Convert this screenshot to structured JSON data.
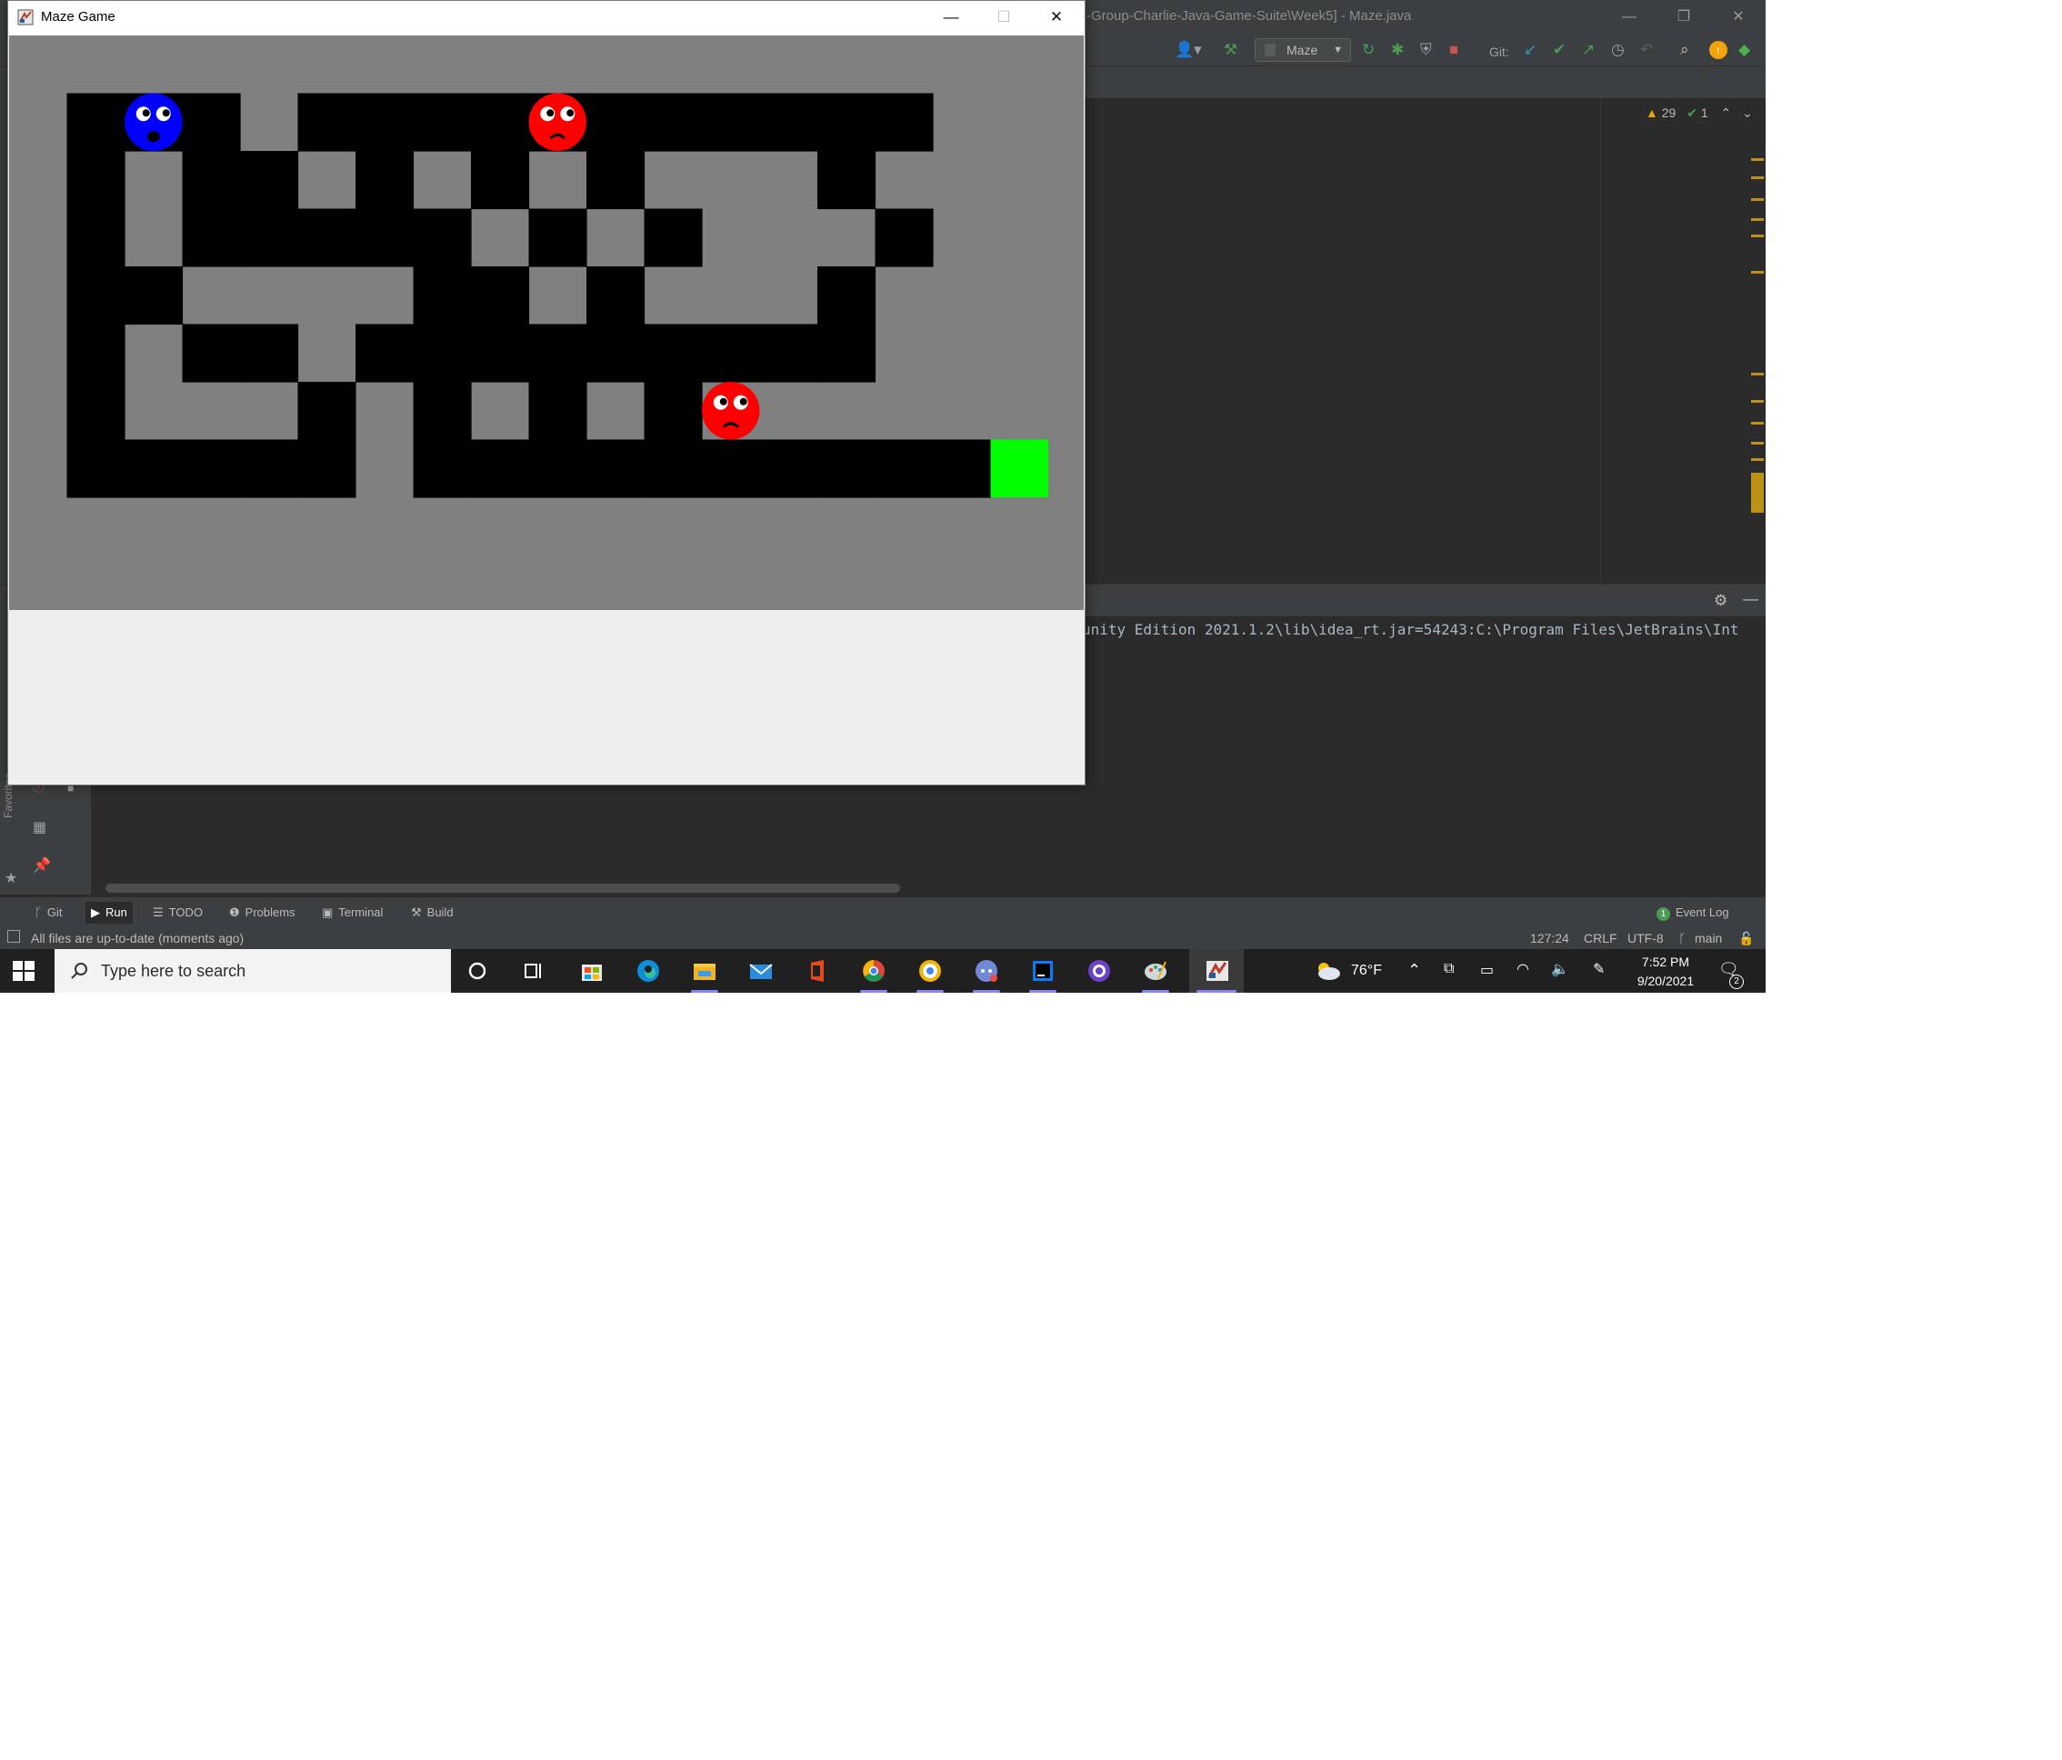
{
  "ide": {
    "title": "-Group-Charlie-Java-Game-Suite\\Week5] - Maze.java",
    "run_config": "Maze",
    "git_label": "Git:",
    "warnings_count": "29",
    "ok_count": "1",
    "console_line": "unity Edition 2021.1.2\\lib\\idea_rt.jar=54243:C:\\Program Files\\JetBrains\\Int",
    "favorites_label": "Favorites",
    "bottom_tabs": [
      "Git",
      "Run",
      "TODO",
      "Problems",
      "Terminal",
      "Build"
    ],
    "event_log": "Event Log",
    "event_log_count": "1",
    "status": {
      "message": "All files are up-to-date (moments ago)",
      "position": "127:24",
      "line_sep": "CRLF",
      "encoding": "UTF-8",
      "branch": "main"
    }
  },
  "maze_window": {
    "title": "Maze Game",
    "colors": {
      "background": "#808080",
      "path": "#000000",
      "player": "#0000ff",
      "enemy": "#ff0000",
      "goal": "#00ff00"
    },
    "grid": [
      "                  ",
      " ### ########### ",
      " # ## # # #   # ",
      " # ##### # #   # ",
      " ##    ## #   # ",
      " # ## #########  ",
      " #   # # # # ",
      " ##### ########## ",
      "                  "
    ],
    "entities": [
      {
        "type": "player",
        "face": "scared",
        "row": 1,
        "col": 2
      },
      {
        "type": "enemy",
        "face": "frown",
        "row": 1,
        "col": 9
      },
      {
        "type": "enemy",
        "face": "frown",
        "row": 6,
        "col": 12
      },
      {
        "type": "goal",
        "row": 7,
        "col": 17
      }
    ]
  },
  "taskbar": {
    "search_placeholder": "Type here to search",
    "weather": "76°F",
    "time": "7:52 PM",
    "date": "9/20/2021",
    "notifications": "2"
  }
}
